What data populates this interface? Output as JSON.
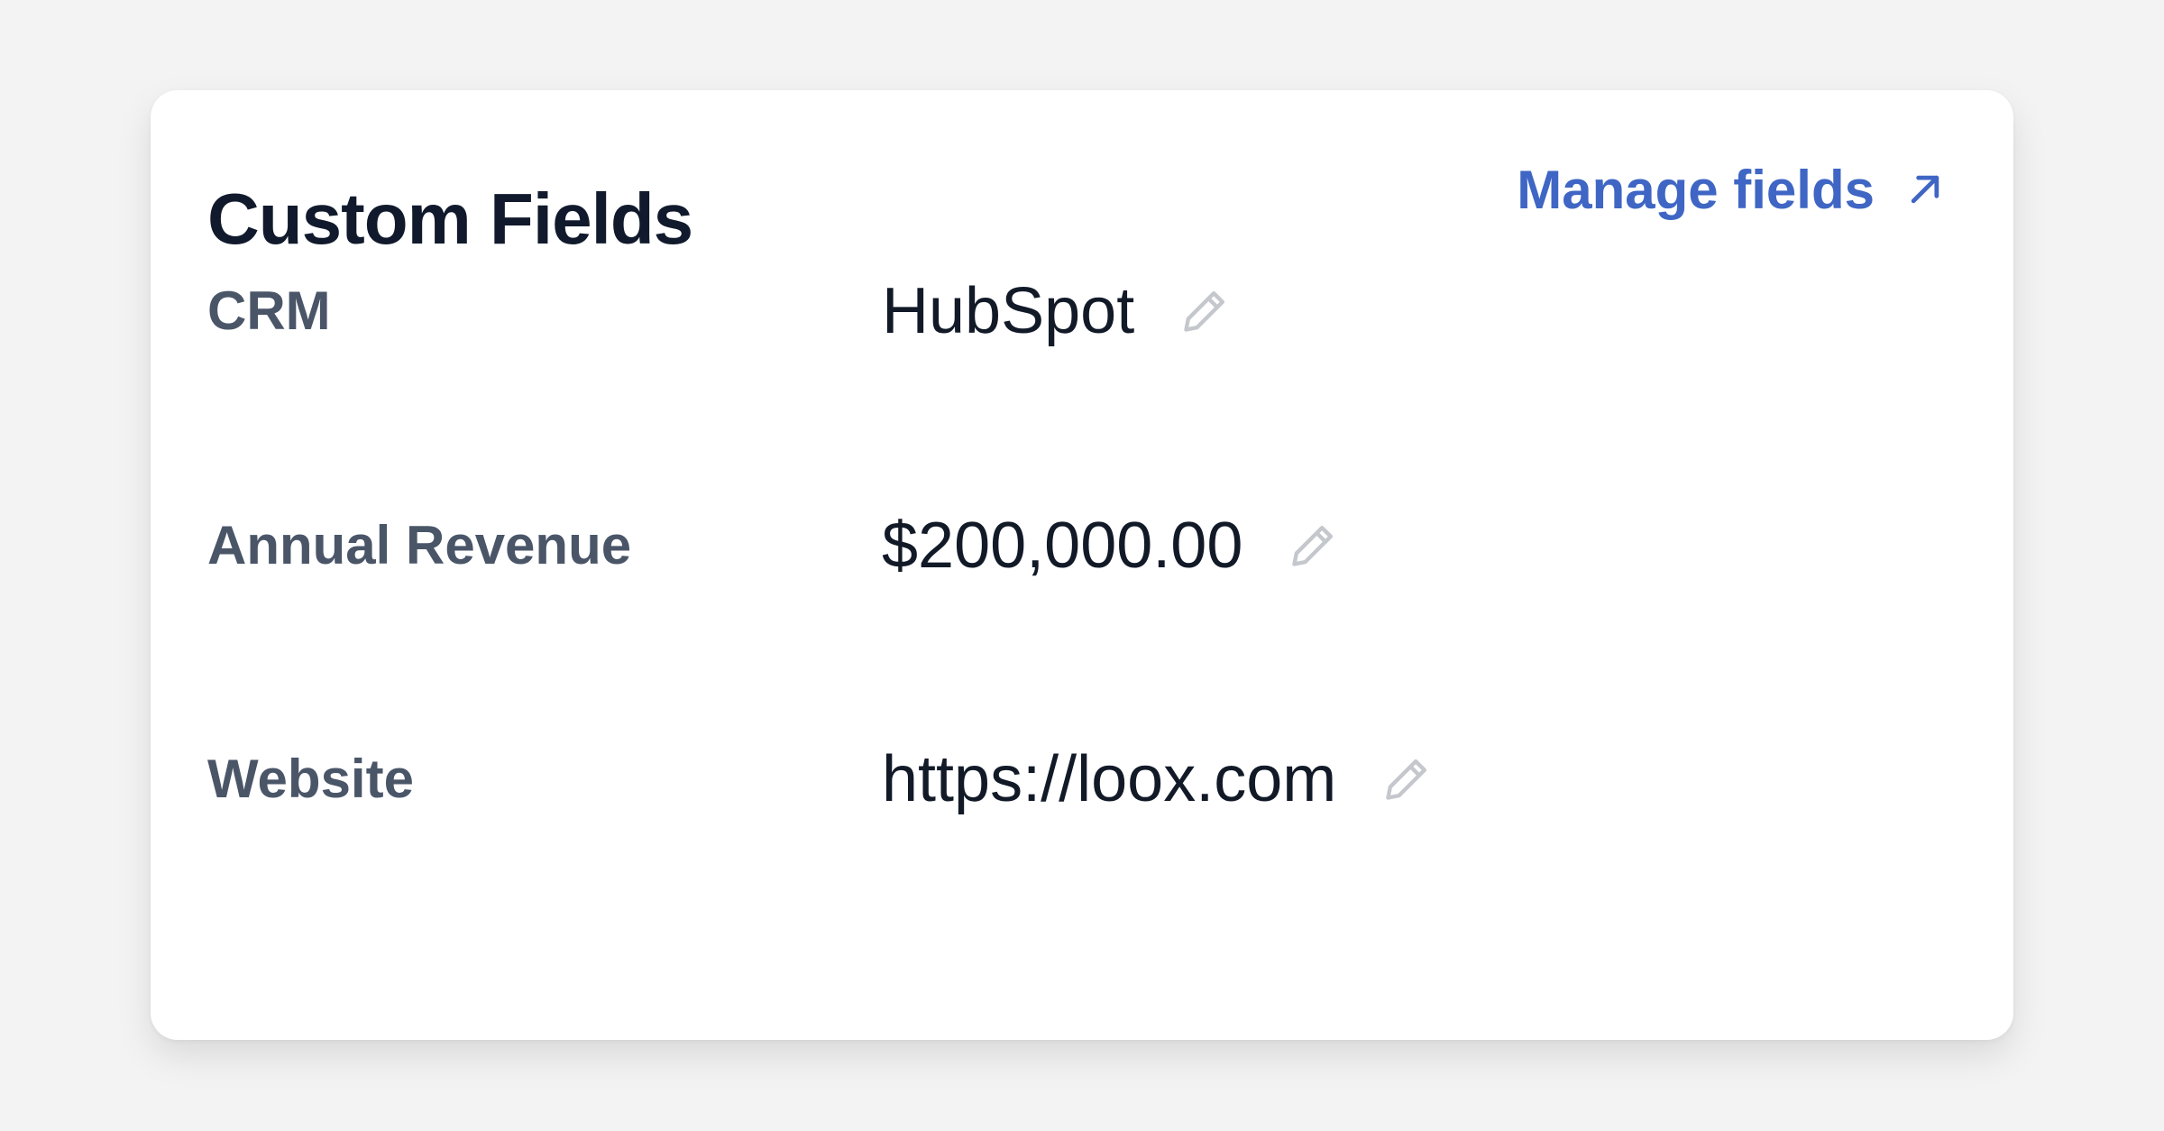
{
  "card": {
    "title": "Custom Fields",
    "manage_link": {
      "label": "Manage fields",
      "icon": "arrow-up-right-icon"
    },
    "fields": [
      {
        "label": "CRM",
        "value": "HubSpot",
        "icon": "pencil-icon"
      },
      {
        "label": "Annual Revenue",
        "value": "$200,000.00",
        "icon": "pencil-icon"
      },
      {
        "label": "Website",
        "value": "https://loox.com",
        "icon": "pencil-icon"
      }
    ]
  },
  "colors": {
    "background": "#f3f3f3",
    "card": "#ffffff",
    "title": "#111a2c",
    "label": "#4a5668",
    "value": "#121a28",
    "link": "#3f66c4",
    "edit_icon": "#c4c7cc"
  }
}
